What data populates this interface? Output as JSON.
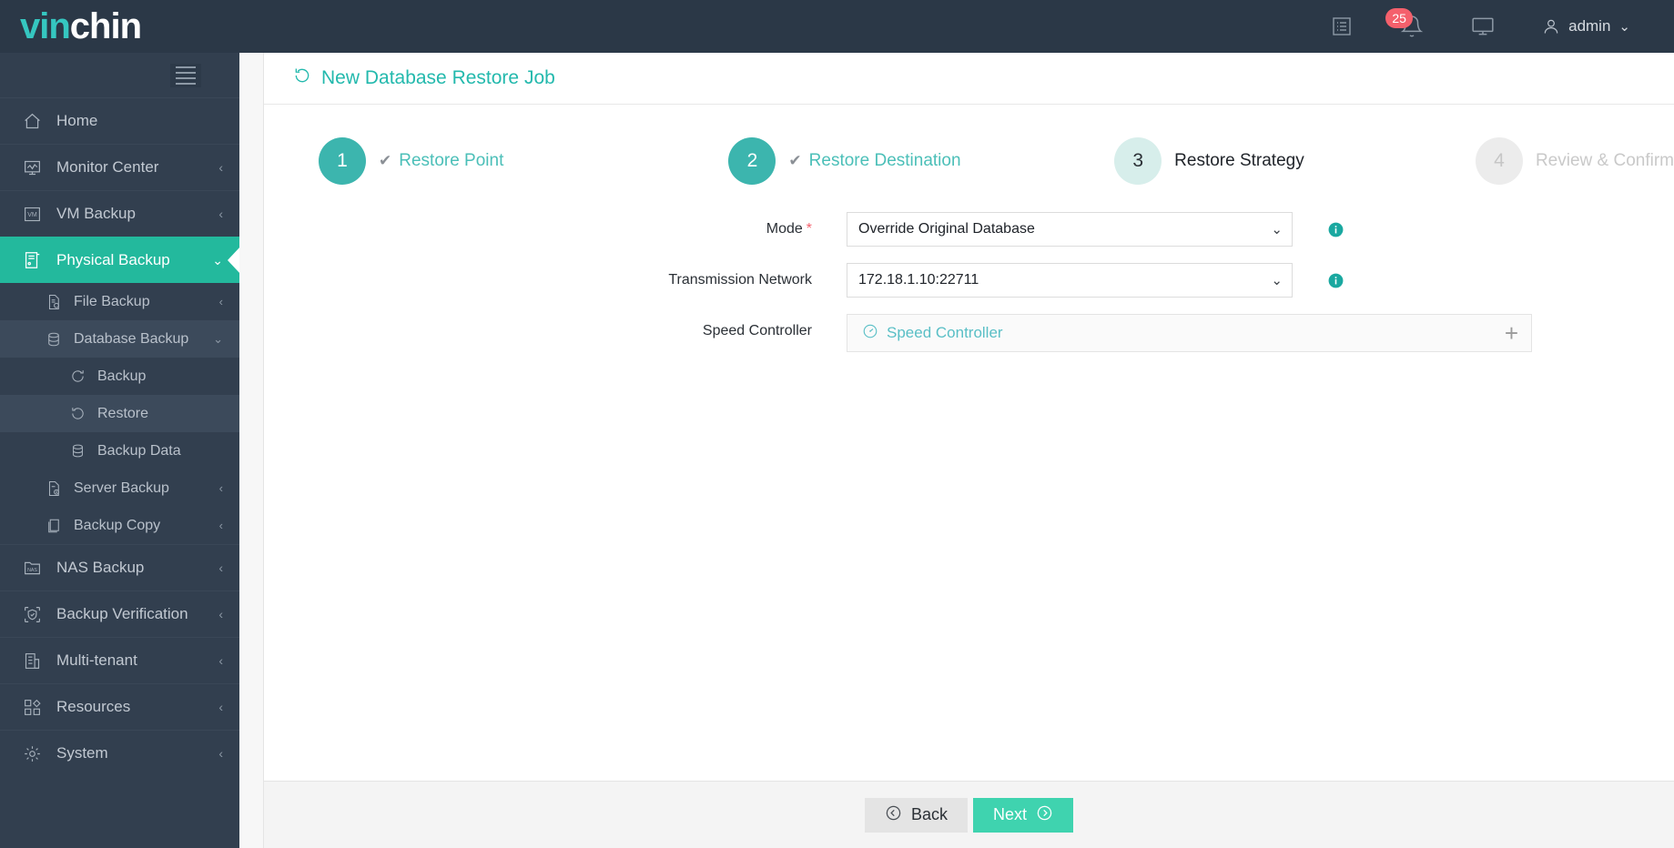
{
  "brand": {
    "part1": "vin",
    "part2": "chin"
  },
  "header": {
    "notifications_icon": "list-icon",
    "bell_icon": "bell-icon",
    "badge_count": "25",
    "monitor_icon": "monitor-icon",
    "user_icon": "user-icon",
    "user_name": "admin",
    "chevron_icon": "chevron-down-icon"
  },
  "sidebar": {
    "toggle_icon": "hamburger-icon",
    "items": [
      {
        "label": "Home",
        "icon": "home-icon",
        "caret": "",
        "state": "normal"
      },
      {
        "label": "Monitor Center",
        "icon": "monitor-chart-icon",
        "caret": "‹",
        "state": "normal"
      },
      {
        "label": "VM Backup",
        "icon": "vm-icon",
        "caret": "‹",
        "state": "normal"
      },
      {
        "label": "Physical Backup",
        "icon": "server-icon",
        "caret": "⌄",
        "state": "active"
      }
    ],
    "sub_items": [
      {
        "label": "File Backup",
        "icon": "file-backup-icon",
        "caret": "‹",
        "level": 1,
        "state": "normal"
      },
      {
        "label": "Database Backup",
        "icon": "database-icon",
        "caret": "⌄",
        "level": 1,
        "state": "open"
      },
      {
        "label": "Backup",
        "icon": "refresh-cw-icon",
        "caret": "",
        "level": 2,
        "state": "normal"
      },
      {
        "label": "Restore",
        "icon": "restore-icon",
        "caret": "",
        "level": 2,
        "state": "selected"
      },
      {
        "label": "Backup Data",
        "icon": "database-icon",
        "caret": "",
        "level": 2,
        "state": "normal"
      },
      {
        "label": "Server Backup",
        "icon": "server-backup-icon",
        "caret": "‹",
        "level": 1,
        "state": "normal"
      },
      {
        "label": "Backup Copy",
        "icon": "copy-icon",
        "caret": "‹",
        "level": 1,
        "state": "normal"
      }
    ],
    "items_bottom": [
      {
        "label": "NAS Backup",
        "icon": "nas-icon",
        "caret": "‹"
      },
      {
        "label": "Backup Verification",
        "icon": "shield-icon",
        "caret": "‹"
      },
      {
        "label": "Multi-tenant",
        "icon": "building-icon",
        "caret": "‹"
      },
      {
        "label": "Resources",
        "icon": "resources-icon",
        "caret": "‹"
      },
      {
        "label": "System",
        "icon": "gear-icon",
        "caret": "‹"
      }
    ]
  },
  "page": {
    "title": "New Database Restore Job",
    "title_icon": "restore-icon"
  },
  "wizard": {
    "steps": [
      {
        "number": "1",
        "label": "Restore Point",
        "state": "done",
        "check": "✔"
      },
      {
        "number": "2",
        "label": "Restore Destination",
        "state": "done",
        "check": "✔"
      },
      {
        "number": "3",
        "label": "Restore Strategy",
        "state": "current",
        "check": ""
      },
      {
        "number": "4",
        "label": "Review & Confirm",
        "state": "todo",
        "check": ""
      }
    ]
  },
  "form": {
    "mode": {
      "label": "Mode",
      "required": "*",
      "value": "Override Original Database",
      "chevron": "⌄",
      "info_icon": "info-icon"
    },
    "transmission_network": {
      "label": "Transmission Network",
      "value": "172.18.1.10:22711",
      "chevron": "⌄",
      "info_icon": "info-icon"
    },
    "speed_controller": {
      "label": "Speed Controller",
      "panel_title": "Speed Controller",
      "panel_icon": "speedometer-icon",
      "add_icon": "+"
    }
  },
  "footer": {
    "back_label": "Back",
    "back_icon": "arrow-left-circle-icon",
    "next_label": "Next",
    "next_icon": "arrow-right-circle-icon"
  },
  "colors": {
    "brand_teal": "#35c6c0",
    "active_green": "#23b99d",
    "step_teal": "#3cb5ae",
    "next_green": "#3fd3af",
    "badge_red": "#f4606c",
    "sidebar_bg": "#323f4f",
    "topbar_bg": "#2b3847"
  }
}
